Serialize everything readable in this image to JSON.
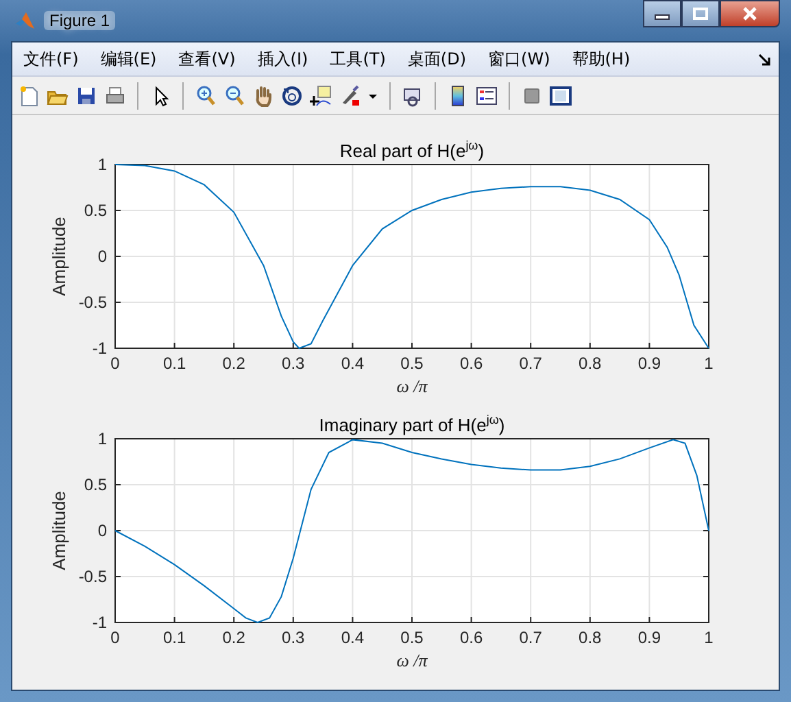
{
  "window": {
    "title": "Figure 1"
  },
  "menu": [
    {
      "label": "文件(F)"
    },
    {
      "label": "编辑(E)"
    },
    {
      "label": "查看(V)"
    },
    {
      "label": "插入(I)"
    },
    {
      "label": "工具(T)"
    },
    {
      "label": "桌面(D)"
    },
    {
      "label": "窗口(W)"
    },
    {
      "label": "帮助(H)"
    }
  ],
  "plots": [
    {
      "chart_data": {
        "type": "line",
        "title": "Real part of H(e$^{jω}$)",
        "xlabel": "ω /π",
        "ylabel": "Amplitude",
        "x": [
          0,
          0.05,
          0.1,
          0.15,
          0.2,
          0.25,
          0.28,
          0.3,
          0.31,
          0.33,
          0.35,
          0.4,
          0.45,
          0.5,
          0.55,
          0.6,
          0.65,
          0.7,
          0.75,
          0.8,
          0.85,
          0.9,
          0.93,
          0.95,
          0.975,
          1
        ],
        "series": [
          {
            "color": "#0072bd",
            "values": [
              1,
              0.99,
              0.93,
              0.78,
              0.48,
              -0.1,
              -0.65,
              -0.93,
              -1,
              -0.95,
              -0.7,
              -0.1,
              0.3,
              0.5,
              0.62,
              0.7,
              0.74,
              0.76,
              0.76,
              0.72,
              0.62,
              0.4,
              0.1,
              -0.2,
              -0.75,
              -1
            ]
          }
        ],
        "xlim": [
          0,
          1
        ],
        "ylim": [
          -1,
          1
        ],
        "xticks": [
          0,
          0.1,
          0.2,
          0.3,
          0.4,
          0.5,
          0.6,
          0.7,
          0.8,
          0.9,
          1
        ],
        "yticks": [
          -1,
          -0.5,
          0,
          0.5,
          1
        ],
        "grid": true
      }
    },
    {
      "chart_data": {
        "type": "line",
        "title": "Imaginary part of H(e$^{jω}$)",
        "xlabel": "ω /π",
        "ylabel": "Amplitude",
        "x": [
          0,
          0.05,
          0.1,
          0.15,
          0.2,
          0.22,
          0.24,
          0.26,
          0.28,
          0.3,
          0.33,
          0.36,
          0.4,
          0.45,
          0.5,
          0.55,
          0.6,
          0.65,
          0.7,
          0.75,
          0.8,
          0.85,
          0.9,
          0.94,
          0.96,
          0.98,
          1
        ],
        "series": [
          {
            "color": "#0072bd",
            "values": [
              0,
              -0.17,
              -0.37,
              -0.6,
              -0.85,
              -0.95,
              -1,
              -0.95,
              -0.72,
              -0.3,
              0.45,
              0.85,
              0.99,
              0.95,
              0.85,
              0.78,
              0.72,
              0.68,
              0.66,
              0.66,
              0.7,
              0.78,
              0.9,
              0.99,
              0.95,
              0.6,
              0
            ]
          }
        ],
        "xlim": [
          0,
          1
        ],
        "ylim": [
          -1,
          1
        ],
        "xticks": [
          0,
          0.1,
          0.2,
          0.3,
          0.4,
          0.5,
          0.6,
          0.7,
          0.8,
          0.9,
          1
        ],
        "yticks": [
          -1,
          -0.5,
          0,
          0.5,
          1
        ],
        "grid": true
      }
    }
  ]
}
